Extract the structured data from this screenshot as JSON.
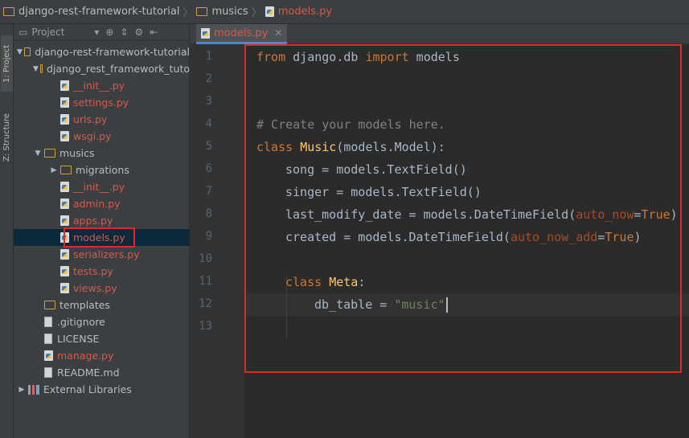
{
  "breadcrumb": {
    "project": "django-rest-framework-tutorial",
    "folder": "musics",
    "file": "models.py"
  },
  "toolstrip": {
    "project_tab": "1: Project",
    "structure_tab": "Z: Structure"
  },
  "panel": {
    "title": "Project"
  },
  "tree": [
    {
      "label": "django-rest-framework-tutorial",
      "kind": "folder",
      "expanded": true
    },
    {
      "label": "django_rest_framework_tuto",
      "kind": "folder",
      "expanded": true
    },
    {
      "label": "__init__.py",
      "kind": "py"
    },
    {
      "label": "settings.py",
      "kind": "py"
    },
    {
      "label": "urls.py",
      "kind": "py"
    },
    {
      "label": "wsgi.py",
      "kind": "py"
    },
    {
      "label": "musics",
      "kind": "folder",
      "expanded": true
    },
    {
      "label": "migrations",
      "kind": "folder",
      "expanded": false
    },
    {
      "label": "__init__.py",
      "kind": "py"
    },
    {
      "label": "admin.py",
      "kind": "py"
    },
    {
      "label": "apps.py",
      "kind": "py"
    },
    {
      "label": "models.py",
      "kind": "py",
      "selected": true
    },
    {
      "label": "serializers.py",
      "kind": "py"
    },
    {
      "label": "tests.py",
      "kind": "py"
    },
    {
      "label": "views.py",
      "kind": "py"
    },
    {
      "label": "templates",
      "kind": "folder"
    },
    {
      "label": ".gitignore",
      "kind": "text"
    },
    {
      "label": "LICENSE",
      "kind": "text"
    },
    {
      "label": "manage.py",
      "kind": "py"
    },
    {
      "label": "README.md",
      "kind": "text"
    },
    {
      "label": "External Libraries",
      "kind": "lib",
      "expanded": false
    }
  ],
  "editor": {
    "tab_label": "models.py",
    "line_numbers": [
      "1",
      "2",
      "3",
      "4",
      "5",
      "6",
      "7",
      "8",
      "9",
      "10",
      "11",
      "12",
      "13"
    ],
    "lines": {
      "l1": {
        "kw_from": "from",
        "mod": " django.db ",
        "kw_import": "import",
        "rest": " models"
      },
      "l4": {
        "comment": "# Create your models here."
      },
      "l5": {
        "kw": "class",
        "name": "Music",
        "rest": "(models.Model):"
      },
      "l6": {
        "text": "song = models.TextField()"
      },
      "l7": {
        "text": "singer = models.TextField()"
      },
      "l8": {
        "pre": "last_modify_date = models.DateTimeField(",
        "param": "auto_now",
        "eq": "=",
        "val": "True",
        "post": ")"
      },
      "l9": {
        "pre": "created = models.DateTimeField(",
        "param": "auto_now_add",
        "eq": "=",
        "val": "True",
        "post": ")"
      },
      "l11": {
        "kw": "class",
        "name": "Meta",
        "rest": ":"
      },
      "l12": {
        "pre": "db_table = ",
        "str": "\"music\""
      }
    }
  },
  "colors": {
    "accent_red": "#e0282a",
    "file_red": "#d35b4d",
    "keyword": "#cc7832",
    "class_name": "#ffc66d",
    "string": "#6a8759",
    "comment": "#808080"
  }
}
